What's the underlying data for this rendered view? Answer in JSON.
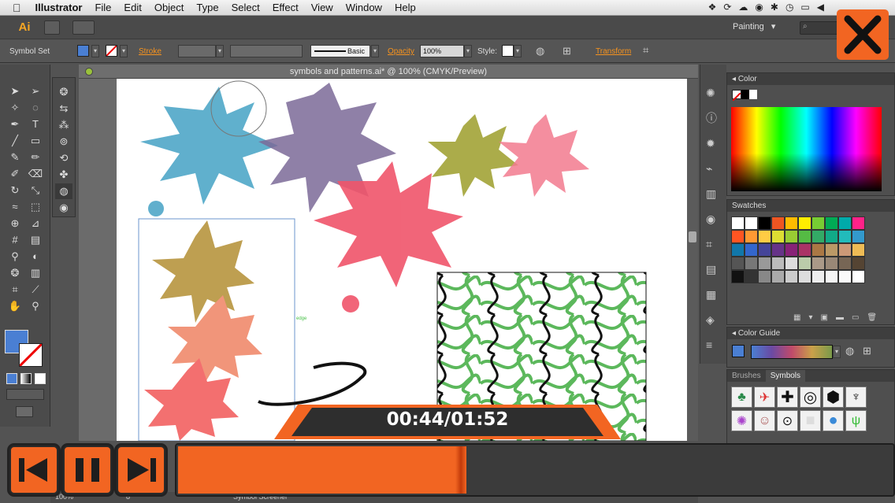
{
  "menubar": {
    "apple": "",
    "app_name": "Illustrator",
    "items": [
      "File",
      "Edit",
      "Object",
      "Type",
      "Select",
      "Effect",
      "View",
      "Window",
      "Help"
    ]
  },
  "appbar": {
    "logo": "Ai",
    "workspace": "Painting",
    "workspace_caret": "▾",
    "search_placeholder": ""
  },
  "control_bar": {
    "selection_label": "Symbol Set",
    "stroke_label": "Stroke",
    "brush_label": "Basic",
    "opacity_label": "Opacity",
    "opacity_value": "100%",
    "style_label": "Style:",
    "transform_label": "Transform",
    "fill_color": "#4a7fd3"
  },
  "document": {
    "title": "symbols and patterns.ai* @ 100% (CMYK/Preview)"
  },
  "canvas": {
    "anchor_label": "edge"
  },
  "panels": {
    "color_title": "Color",
    "swatches_title": "Swatches",
    "color_guide_title": "Color Guide",
    "brushes_tab": "Brushes",
    "symbols_tab": "Symbols"
  },
  "status": {
    "zoom": "100%",
    "artboard_num": "8",
    "tool_name": "Symbol Screener"
  },
  "player": {
    "time": "00:44/01:52",
    "progress": 0.4,
    "accent": "#f26522"
  },
  "colors": {
    "accent": "#f26522",
    "panel_bg": "#4f4f4f"
  }
}
